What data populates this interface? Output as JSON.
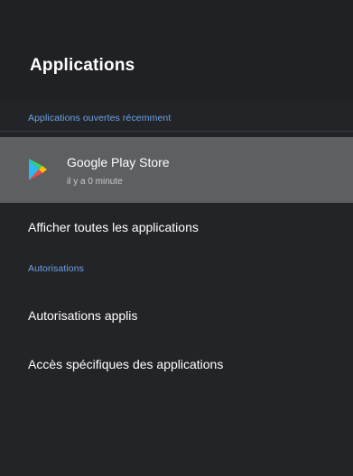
{
  "header": {
    "title": "Applications"
  },
  "recent": {
    "section_label": "Applications ouvertes récemment",
    "apps": [
      {
        "name": "Google Play Store",
        "subtitle": "il y a 0 minute",
        "icon": "google-play-icon"
      }
    ]
  },
  "menu": {
    "show_all_label": "Afficher toutes les applications",
    "permissions_section_label": "Autorisations",
    "app_permissions_label": "Autorisations applis",
    "special_access_label": "Accès spécifiques des applications"
  },
  "colors": {
    "background": "#232428",
    "header_background": "#202125",
    "section_accent": "#6ea3e6",
    "selected_row": "#5d5f61",
    "text_primary": "#ffffff",
    "text_secondary": "#c9cacc"
  }
}
